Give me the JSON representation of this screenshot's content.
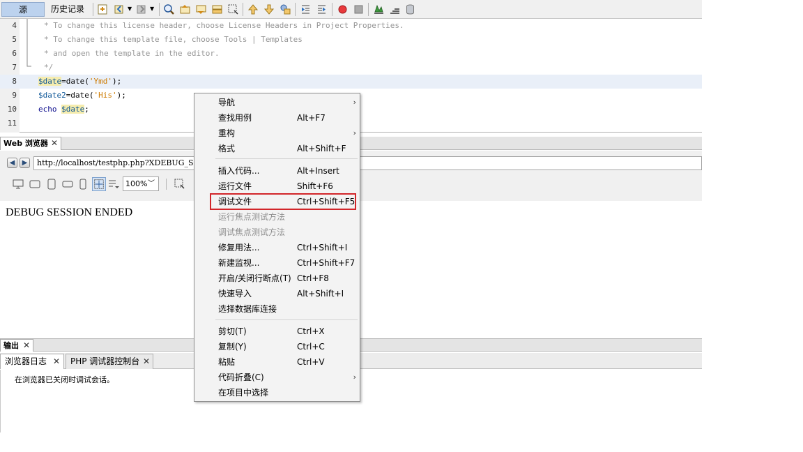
{
  "editor_toolbar": {
    "source_tab": "源",
    "history_tab": "历史记录"
  },
  "code_lines": [
    {
      "num": "4",
      "text": "* To change this license header, choose License Headers in Project Properties."
    },
    {
      "num": "5",
      "text": "* To change this template file, choose Tools | Templates"
    },
    {
      "num": "6",
      "text": "* and open the template in the editor."
    },
    {
      "num": "7",
      "text": "*/"
    },
    {
      "num": "8",
      "var": "$date",
      "rest": "=date(",
      "str": "'Ymd'",
      "end": ");"
    },
    {
      "num": "9",
      "var": "$date2",
      "rest": "=date(",
      "str": "'His'",
      "end": ");"
    },
    {
      "num": "10",
      "kw": "echo ",
      "var": "$date",
      "end": ";"
    },
    {
      "num": "11",
      "text": ""
    }
  ],
  "browser": {
    "tab_label": "Web 浏览器",
    "url": "http://localhost/testphp.php?XDEBUG_SESSION_STOP",
    "zoom": "100%",
    "content_text": "DEBUG SESSION ENDED"
  },
  "output": {
    "tab_label": "输出",
    "subtab_browser_log": "浏览器日志",
    "subtab_php_console": "PHP 调试器控制台",
    "log_line": "在浏览器已关闭时调试会话。"
  },
  "context_menu": {
    "items": [
      {
        "label": "导航",
        "shortcut": "",
        "submenu": true,
        "disabled": false
      },
      {
        "label": "查找用例",
        "shortcut": "Alt+F7",
        "submenu": false,
        "disabled": false
      },
      {
        "label": "重构",
        "shortcut": "",
        "submenu": true,
        "disabled": false
      },
      {
        "label": "格式",
        "shortcut": "Alt+Shift+F",
        "submenu": false,
        "disabled": false
      },
      {
        "label": "插入代码...",
        "shortcut": "Alt+Insert",
        "submenu": false,
        "disabled": false
      },
      {
        "label": "运行文件",
        "shortcut": "Shift+F6",
        "submenu": false,
        "disabled": false
      },
      {
        "label": "调试文件",
        "shortcut": "Ctrl+Shift+F5",
        "submenu": false,
        "disabled": false
      },
      {
        "label": "运行焦点测试方法",
        "shortcut": "",
        "submenu": false,
        "disabled": true
      },
      {
        "label": "调试焦点测试方法",
        "shortcut": "",
        "submenu": false,
        "disabled": true
      },
      {
        "label": "修复用法...",
        "shortcut": "Ctrl+Shift+I",
        "submenu": false,
        "disabled": false
      },
      {
        "label": "新建监视...",
        "shortcut": "Ctrl+Shift+F7",
        "submenu": false,
        "disabled": false
      },
      {
        "label": "开启/关闭行断点(T)",
        "shortcut": "Ctrl+F8",
        "submenu": false,
        "disabled": false
      },
      {
        "label": "快速导入",
        "shortcut": "Alt+Shift+I",
        "submenu": false,
        "disabled": false
      },
      {
        "label": "选择数据库连接",
        "shortcut": "",
        "submenu": false,
        "disabled": false
      },
      {
        "label": "剪切(T)",
        "shortcut": "Ctrl+X",
        "submenu": false,
        "disabled": false
      },
      {
        "label": "复制(Y)",
        "shortcut": "Ctrl+C",
        "submenu": false,
        "disabled": false
      },
      {
        "label": "粘贴",
        "shortcut": "Ctrl+V",
        "submenu": false,
        "disabled": false
      },
      {
        "label": "代码折叠(C)",
        "shortcut": "",
        "submenu": true,
        "disabled": false
      },
      {
        "label": "在项目中选择",
        "shortcut": "",
        "submenu": false,
        "disabled": false
      }
    ],
    "highlight_color": "#d2262a"
  }
}
